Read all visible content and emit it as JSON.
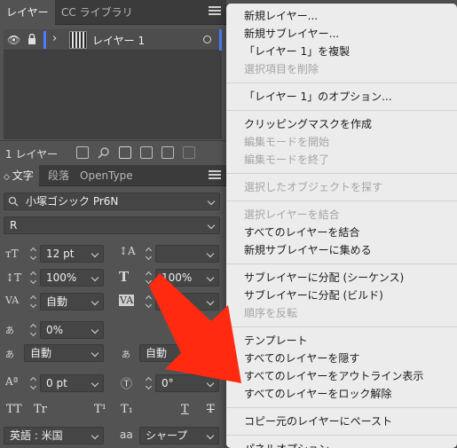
{
  "layers_panel": {
    "tabs": [
      "レイヤー",
      "CC ライブラリ"
    ],
    "layer": {
      "name": "レイヤー 1"
    },
    "footer_count": "1 レイヤー"
  },
  "character_panel": {
    "tabs": [
      "文字",
      "段落",
      "OpenType"
    ],
    "font_family": "小塚ゴシック Pr6N",
    "font_style": "R",
    "font_size": "12 pt",
    "leading": "",
    "vertical_scale": "100%",
    "horizontal_scale": "100%",
    "kerning": "自動",
    "tracking": "",
    "tsume": "0%",
    "aki_left": "自動",
    "aki_right": "自動",
    "baseline_shift": "0 pt",
    "rotation": "0°",
    "language": "英語 : 米国",
    "antialias": "シャープ",
    "type_buttons": [
      "TT",
      "Tr",
      "T¹",
      "T₁",
      "T",
      "T"
    ],
    "icons": {
      "kerning_label": "VA",
      "tracking_label": "VA",
      "antialias_label": "aa"
    }
  },
  "menu": {
    "groups": [
      [
        {
          "label": "新規レイヤー...",
          "disabled": false
        },
        {
          "label": "新規サブレイヤー...",
          "disabled": false
        },
        {
          "label": "「レイヤー 1」を複製",
          "disabled": false
        },
        {
          "label": "選択項目を削除",
          "disabled": true
        }
      ],
      [
        {
          "label": "「レイヤー 1」のオプション...",
          "disabled": false
        }
      ],
      [
        {
          "label": "クリッピングマスクを作成",
          "disabled": false
        },
        {
          "label": "編集モードを開始",
          "disabled": true
        },
        {
          "label": "編集モードを終了",
          "disabled": true
        }
      ],
      [
        {
          "label": "選択したオブジェクトを探す",
          "disabled": true
        }
      ],
      [
        {
          "label": "選択レイヤーを結合",
          "disabled": true
        },
        {
          "label": "すべてのレイヤーを結合",
          "disabled": false
        },
        {
          "label": "新規サブレイヤーに集める",
          "disabled": false
        }
      ],
      [
        {
          "label": "サブレイヤーに分配 (シーケンス)",
          "disabled": false
        },
        {
          "label": "サブレイヤーに分配 (ビルド)",
          "disabled": false
        },
        {
          "label": "順序を反転",
          "disabled": true
        }
      ],
      [
        {
          "label": "テンプレート",
          "disabled": false
        },
        {
          "label": "すべてのレイヤーを隠す",
          "disabled": false
        },
        {
          "label": "すべてのレイヤーをアウトライン表示",
          "disabled": false
        },
        {
          "label": "すべてのレイヤーをロック解除",
          "disabled": false
        }
      ],
      [
        {
          "label": "コピー元のレイヤーにペースト",
          "disabled": false
        }
      ],
      [
        {
          "label": "パネルオプション...",
          "disabled": false
        }
      ]
    ]
  },
  "colors": {
    "accent": "#4f7cff",
    "arrow": "#ff2a0f"
  }
}
